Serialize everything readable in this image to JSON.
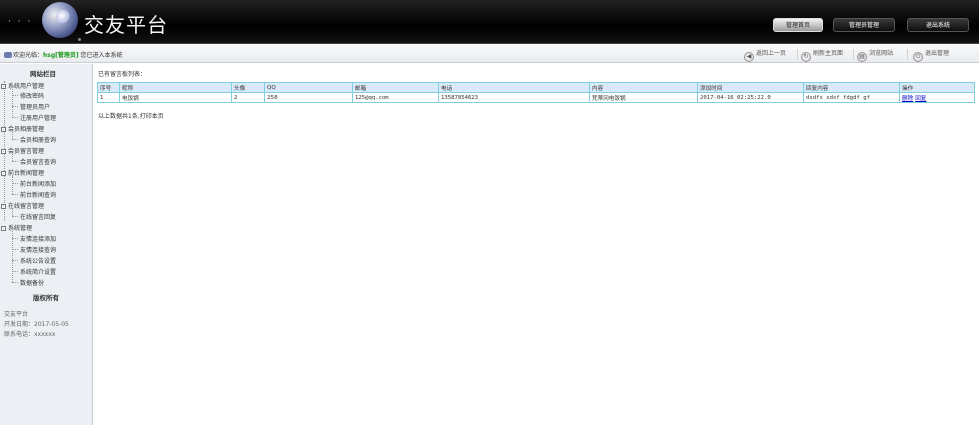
{
  "header": {
    "title": "交友平台",
    "buttons": [
      {
        "label": "管理首页",
        "active": true
      },
      {
        "label": "管理员管理",
        "active": false
      },
      {
        "label": "退出系统",
        "active": false
      }
    ]
  },
  "topbar": {
    "welcome_prefix": "欢迎光临：",
    "user": "hsg[管理员]",
    "welcome_suffix": " 您已进入本系统",
    "buttons": [
      {
        "label": "返回上一页",
        "icon": "back-icon"
      },
      {
        "label": "刷新主页面",
        "icon": "refresh-icon"
      },
      {
        "label": "浏览网站",
        "icon": "browse-icon"
      },
      {
        "label": "退出管理",
        "icon": "power-icon"
      }
    ]
  },
  "sidebar": {
    "title": "网站栏目",
    "groups": [
      {
        "label": "系统用户管理",
        "items": [
          "修改密码",
          "管理员用户",
          "注册用户管理"
        ]
      },
      {
        "label": "会员相册管理",
        "items": [
          "会员相册查询"
        ]
      },
      {
        "label": "会员留言管理",
        "items": [
          "会员留言查询"
        ]
      },
      {
        "label": "前台新闻管理",
        "items": [
          "前台新闻添加",
          "前台新闻查询"
        ]
      },
      {
        "label": "在线留言管理",
        "items": [
          "在线留言回复"
        ]
      },
      {
        "label": "系统管理",
        "items": [
          "友情连接添加",
          "友情连接查询",
          "系统公告设置",
          "系统简介设置",
          "数据备份"
        ]
      }
    ],
    "copyright": "版权所有",
    "footer": {
      "name": "交友平台",
      "dev_date": "开发日期：2017-05-05",
      "phone": "联系电话：xxxxxx"
    }
  },
  "main": {
    "caption": "已有留言板列表：",
    "columns": [
      "序号",
      "昵称",
      "头像",
      "QQ",
      "邮箱",
      "电话",
      "内容",
      "添加时间",
      "回复内容",
      "操作"
    ],
    "rows": [
      {
        "cells": [
          "1",
          "电饭锅",
          "2",
          "258",
          "125@qq.com",
          "13587854623",
          "梵蒂冈电饭锅",
          "2017-04-16 02:25:22.0",
          "dsdfs sdsf fdgdf gf"
        ],
        "ops": [
          "删除",
          "回复"
        ]
      }
    ],
    "summary": "以上数据共1条,打印本页"
  }
}
